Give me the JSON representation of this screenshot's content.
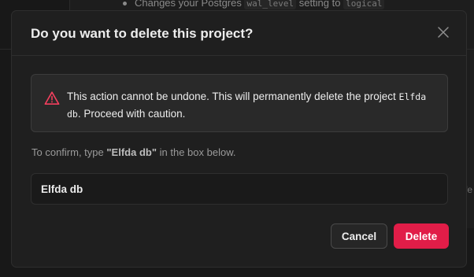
{
  "background": {
    "bullet_prefix": "Changes your Postgres",
    "bullet_code_1": "wal_level",
    "bullet_middle": "setting to",
    "bullet_code_2": "logical",
    "side_text": "fe"
  },
  "modal": {
    "title": "Do you want to delete this project?",
    "close_icon": "close-icon",
    "alert": {
      "icon": "warning-triangle-icon",
      "text_before": "This action cannot be undone. This will permanently delete the project",
      "project_name": "Elfda db",
      "text_after": ". Proceed with caution."
    },
    "confirm": {
      "label_before": "To confirm, type",
      "label_value": "\"Elfda db\"",
      "label_after": "in the box below.",
      "input_value": "Elfda db"
    },
    "buttons": {
      "cancel": "Cancel",
      "delete": "Delete"
    }
  },
  "colors": {
    "danger": "#e11d48",
    "warning_icon": "#f43f5e",
    "modal_bg": "#1f1f1f",
    "alert_bg": "#292929"
  }
}
